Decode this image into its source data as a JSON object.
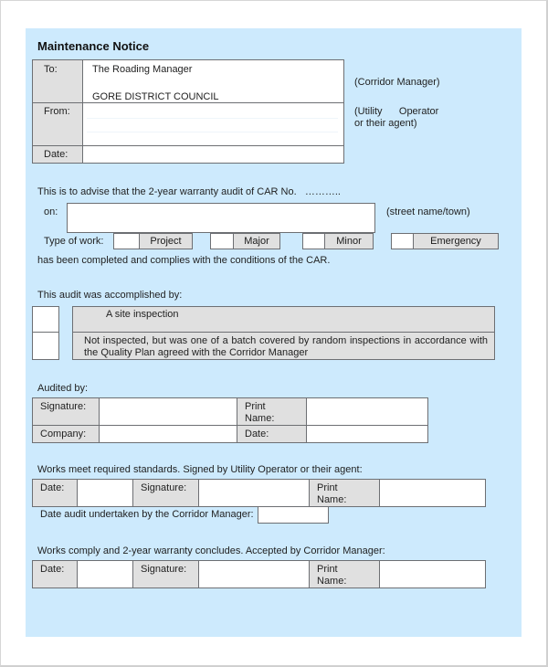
{
  "document": {
    "title": "Maintenance Notice"
  },
  "header_table": {
    "to_label": "To:",
    "to_line1": "The Roading Manager",
    "to_line2": "GORE DISTRICT COUNCIL",
    "from_label": "From:",
    "date_label": "Date:",
    "to_note": "(Corridor Manager)",
    "from_note_line1": "(Utility      Operator",
    "from_note_line2": "or their agent)"
  },
  "advice": {
    "intro": "This is to advise that the 2-year warranty audit of CAR No.   ………..",
    "on_label": "on:",
    "on_value": "",
    "on_note": "(street name/town)",
    "type_label": "Type of work:",
    "work_types": [
      {
        "label": "Project",
        "checked": false
      },
      {
        "label": "Major",
        "checked": false
      },
      {
        "label": "Minor",
        "checked": false
      },
      {
        "label": "Emergency",
        "checked": false
      }
    ],
    "completion": "has been completed and complies with the conditions of the CAR."
  },
  "accomplished": {
    "heading": "This audit was accomplished by:",
    "options": [
      {
        "label": "A site inspection",
        "checked": false
      },
      {
        "label": "Not inspected, but was one of a batch covered by random inspections in accordance with the Quality Plan agreed with the Corridor Manager",
        "checked": false
      }
    ]
  },
  "audited_by": {
    "heading": "Audited by:",
    "signature_label": "Signature:",
    "print_name_label_1": "Print",
    "print_name_label_2": "Name:",
    "company_label": "Company:",
    "date_label": "Date:",
    "signature_value": "",
    "print_name_value": "",
    "company_value": "",
    "date_value": ""
  },
  "utility_signoff": {
    "heading": "Works meet required standards. Signed by Utility Operator or their agent:",
    "date_label": "Date:",
    "signature_label": "Signature:",
    "print_name_label_1": "Print",
    "print_name_label_2": "Name:",
    "audit_date_label": "Date audit undertaken by the Corridor Manager:",
    "audit_date_value": ""
  },
  "corridor_signoff": {
    "heading": "Works comply and 2-year warranty concludes. Accepted by Corridor Manager:",
    "date_label": "Date:",
    "signature_label": "Signature:",
    "print_name_label_1": "Print",
    "print_name_label_2": "Name:"
  }
}
